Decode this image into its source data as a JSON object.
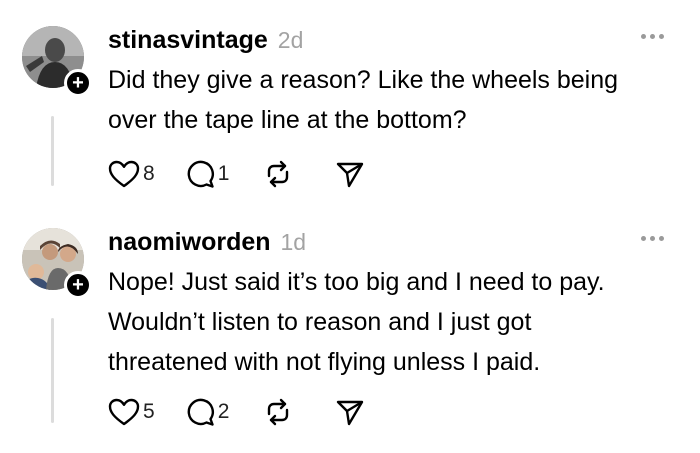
{
  "comments": [
    {
      "username": "stinasvintage",
      "time": "2d",
      "text": "Did they give a reason? Like the wheels being\nover the tape line at the bottom?",
      "likes": "8",
      "replies": "1",
      "icons": [
        "heart-icon",
        "reply-bubble-icon",
        "repost-icon",
        "share-icon",
        "more-icon",
        "follow-plus-icon"
      ]
    },
    {
      "username": "naomiworden",
      "time": "1d",
      "text": "Nope! Just said it’s too big and I need to pay.\nWouldn’t listen to reason and I just got\nthreatened with not flying unless I paid.",
      "likes": "5",
      "replies": "2",
      "icons": [
        "heart-icon",
        "reply-bubble-icon",
        "repost-icon",
        "share-icon",
        "more-icon",
        "follow-plus-icon"
      ]
    }
  ]
}
